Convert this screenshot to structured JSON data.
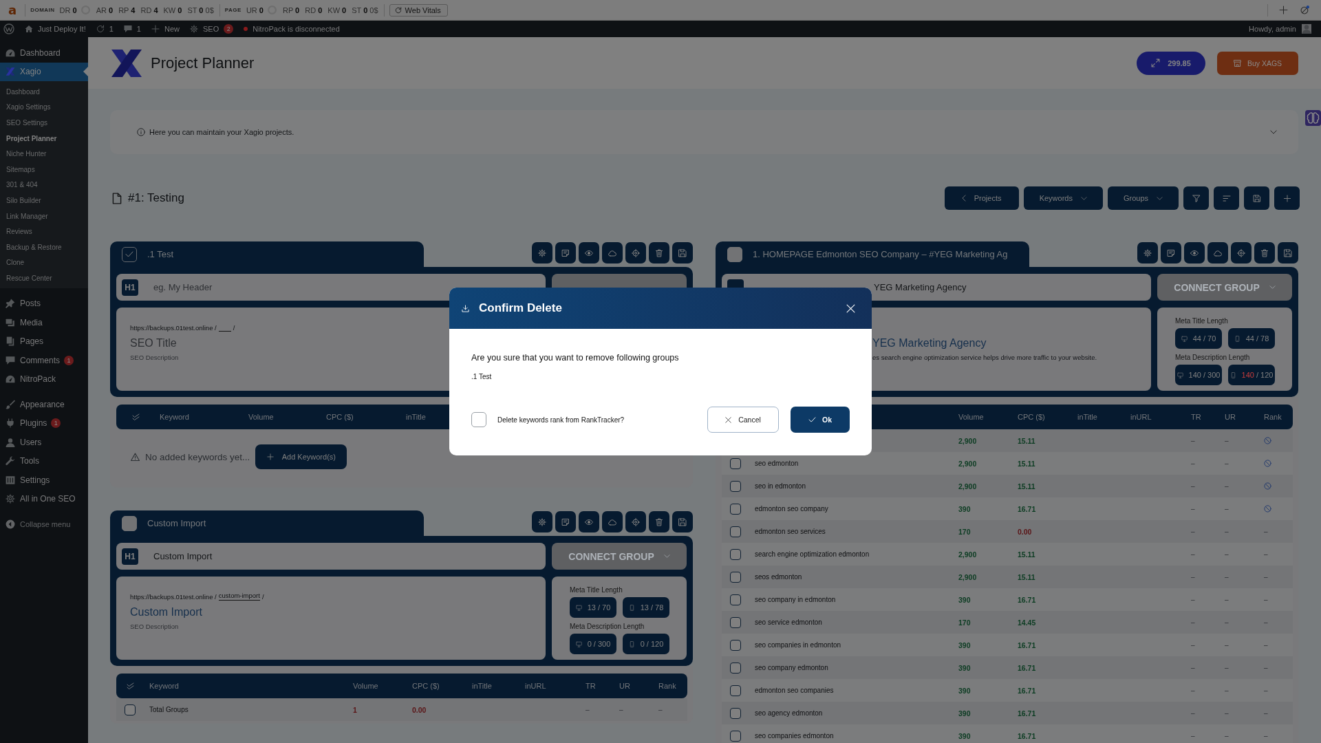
{
  "extension_bar": {
    "logo": "a",
    "sections": [
      {
        "label": "DOMAIN",
        "metrics": [
          {
            "kind": "metric",
            "name": "DR",
            "value": "0"
          },
          {
            "kind": "ring"
          },
          {
            "kind": "metric",
            "name": "AR",
            "value": "0"
          },
          {
            "kind": "metric",
            "name": "RP",
            "value": "4"
          },
          {
            "kind": "metric",
            "name": "RD",
            "value": "4"
          },
          {
            "kind": "metric",
            "name": "KW",
            "value": "0"
          },
          {
            "kind": "metric",
            "name": "ST",
            "value": "0",
            "extra": "0$"
          }
        ]
      },
      {
        "label": "PAGE",
        "metrics": [
          {
            "kind": "metric",
            "name": "UR",
            "value": "0"
          },
          {
            "kind": "ring"
          },
          {
            "kind": "metric",
            "name": "RP",
            "value": "0"
          },
          {
            "kind": "metric",
            "name": "RD",
            "value": "0"
          },
          {
            "kind": "metric",
            "name": "KW",
            "value": "0"
          },
          {
            "kind": "metric",
            "name": "ST",
            "value": "0",
            "extra": "0$"
          }
        ]
      }
    ],
    "button": "Web Vitals"
  },
  "admin_bar": {
    "items": [
      {
        "kind": "logo"
      },
      {
        "kind": "home",
        "label": "Just Deploy It!"
      },
      {
        "kind": "updates",
        "label": "1"
      },
      {
        "kind": "comments",
        "label": "1"
      },
      {
        "kind": "new",
        "label": "New"
      },
      {
        "kind": "seo",
        "label": "SEO",
        "badge": "2"
      },
      {
        "kind": "alert",
        "label": "NitroPack is disconnected"
      }
    ],
    "greeting": "Howdy, admin"
  },
  "sidebar": {
    "menu_groups": [
      [
        {
          "kind": "dashboard",
          "label": "Dashboard",
          "selected": false
        },
        {
          "kind": "xagio",
          "label": "Xagio",
          "selected": true,
          "children": [
            {
              "label": "Dashboard",
              "selected": false
            },
            {
              "label": "Xagio Settings",
              "selected": false
            },
            {
              "label": "SEO Settings",
              "selected": false
            },
            {
              "label": "Project Planner",
              "selected": true
            },
            {
              "label": "Niche Hunter",
              "selected": false
            },
            {
              "label": "Sitemaps",
              "selected": false
            },
            {
              "label": "301 & 404",
              "selected": false
            },
            {
              "label": "Silo Builder",
              "selected": false
            },
            {
              "label": "Link Manager",
              "selected": false
            },
            {
              "label": "Reviews",
              "selected": false
            },
            {
              "label": "Backup & Restore",
              "selected": false
            },
            {
              "label": "Clone",
              "selected": false
            },
            {
              "label": "Rescue Center",
              "selected": false
            }
          ]
        }
      ],
      [
        {
          "kind": "posts",
          "label": "Posts",
          "selected": false
        },
        {
          "kind": "media",
          "label": "Media",
          "selected": false
        },
        {
          "kind": "pages",
          "label": "Pages",
          "selected": false
        },
        {
          "kind": "comments",
          "label": "Comments",
          "badge": "1",
          "selected": false
        },
        {
          "kind": "nitropack",
          "label": "NitroPack",
          "selected": false
        }
      ],
      [
        {
          "kind": "appearance",
          "label": "Appearance",
          "selected": false
        },
        {
          "kind": "plugins",
          "label": "Plugins",
          "badge": "1",
          "selected": false
        },
        {
          "kind": "users",
          "label": "Users",
          "selected": false
        },
        {
          "kind": "tools",
          "label": "Tools",
          "selected": false
        },
        {
          "kind": "settings",
          "label": "Settings",
          "selected": false
        },
        {
          "kind": "aioseo",
          "label": "All in One SEO",
          "selected": false
        }
      ]
    ],
    "collapse": "Collapse menu"
  },
  "header": {
    "title": "Project Planner",
    "buttons": [
      {
        "kind": "credits",
        "label": "299.85"
      },
      {
        "kind": "buy",
        "label": "Buy XAGS"
      }
    ]
  },
  "notice": {
    "text": "Here you can maintain your Xagio projects.",
    "expanded": false
  },
  "project": {
    "title": "#1: Testing",
    "toolbar": [
      {
        "kind": "back",
        "label": "Projects"
      },
      {
        "kind": "dropdown",
        "label": "Keywords"
      },
      {
        "kind": "dropdown",
        "label": "Groups"
      },
      {
        "kind": "filter"
      },
      {
        "kind": "sort"
      },
      {
        "kind": "save"
      },
      {
        "kind": "add"
      }
    ]
  },
  "columns": [
    [
      {
        "title": ".1 Test",
        "checked": true,
        "h1": {
          "badge": "H1",
          "placeholder": "eg. My Header"
        },
        "seo": {
          "url": {
            "base": "https://backups.01test.online /",
            "end": "/"
          },
          "title": {
            "placeholder": "SEO Title"
          },
          "description": {
            "placeholder": "SEO Description"
          }
        },
        "table": {
          "select_all": true,
          "columns": [
            {
              "kind": "keyword",
              "label": "Keyword"
            },
            {
              "kind": "volume",
              "label": "Volume"
            },
            {
              "kind": "cpc",
              "label": "CPC ($)"
            },
            {
              "kind": "intitle",
              "label": "inTitle"
            }
          ],
          "empty": {
            "text": "No added keywords yet...",
            "button": "Add Keyword(s)"
          }
        }
      },
      {
        "title": "Custom Import",
        "checked": false,
        "h1": {
          "badge": "H1",
          "value": "Custom Import"
        },
        "connect": "CONNECT GROUP",
        "seo": {
          "url": {
            "base": "https://backups.01test.online /",
            "slug": "custom-import",
            "end": "/"
          },
          "title": {
            "value": "Custom Import"
          },
          "description": {
            "placeholder": "SEO Description"
          }
        },
        "meta": {
          "title_label": "Meta Title Length",
          "title_counts": [
            {
              "kind": "desktop",
              "count": "13",
              "total": "/ 70",
              "over": false
            },
            {
              "kind": "mobile",
              "count": "13",
              "total": "/ 78",
              "over": false
            }
          ],
          "description_label": "Meta Description Length",
          "description_counts": [
            {
              "kind": "desktop",
              "count": "0",
              "total": "/ 300",
              "over": false
            },
            {
              "kind": "mobile",
              "count": "0",
              "total": "/ 120",
              "over": false
            }
          ]
        },
        "table": {
          "select_all": true,
          "columns": [
            {
              "kind": "keyword",
              "label": "Keyword"
            },
            {
              "kind": "volume",
              "label": "Volume"
            },
            {
              "kind": "cpc",
              "label": "CPC ($)"
            },
            {
              "kind": "intitle",
              "label": "inTitle"
            },
            {
              "kind": "inurl",
              "label": "inURL"
            },
            {
              "kind": "tr",
              "label": "TR"
            },
            {
              "kind": "ur",
              "label": "UR"
            },
            {
              "kind": "rank",
              "label": "Rank"
            }
          ],
          "rows": [
            {
              "checked": false,
              "keyword": "Total Groups",
              "volume": {
                "text": "1",
                "color": "#5a1416"
              },
              "cpc": {
                "text": "0.00",
                "color": "#5a1416"
              },
              "tr": "–",
              "ur": "–",
              "rank": {
                "kind": "text",
                "text": "–"
              }
            }
          ]
        }
      }
    ],
    [
      {
        "title": "1. HOMEPAGE Edmonton SEO Company – #YEG Marketing Ag",
        "checked": false,
        "h1": {
          "value": "YEG Marketing Agency"
        },
        "connect": "CONNECT GROUP",
        "seo": {
          "title": {
            "value": "YEG Marketing Agency"
          },
          "description": {
            "value": "es search engine optimization service helps drive more traffic to your website."
          }
        },
        "meta": {
          "title_label": "Meta Title Length",
          "title_counts": [
            {
              "kind": "desktop",
              "count": "44",
              "total": "/ 70",
              "over": false
            },
            {
              "kind": "mobile",
              "count": "44",
              "total": "/ 78",
              "over": false
            }
          ],
          "description_label": "Meta Description Length",
          "description_counts": [
            {
              "kind": "desktop",
              "count": "140",
              "total": "/ 300",
              "over": false
            },
            {
              "kind": "mobile",
              "count": "140",
              "total": "/ 120",
              "over": true
            }
          ]
        },
        "table": {
          "columns": [
            {
              "kind": "keyword"
            },
            {
              "kind": "volume",
              "label": "Volume"
            },
            {
              "kind": "cpc",
              "label": "CPC ($)"
            },
            {
              "kind": "intitle",
              "label": "inTitle"
            },
            {
              "kind": "inurl",
              "label": "inURL"
            },
            {
              "kind": "tr",
              "label": "TR"
            },
            {
              "kind": "ur",
              "label": "UR"
            },
            {
              "kind": "rank",
              "label": "Rank"
            }
          ],
          "rows": [
            {
              "volume": {
                "text": "2,900",
                "color": "#0c3c22"
              },
              "cpc": {
                "text": "15.11",
                "color": "#0c3c22"
              },
              "tr": "–",
              "ur": "–",
              "rank": {
                "kind": "icon"
              }
            },
            {
              "checked": false,
              "keyword": "seo edmonton",
              "volume": {
                "text": "2,900",
                "color": "#0c3c22"
              },
              "cpc": {
                "text": "15.11",
                "color": "#0c3c22"
              },
              "tr": "–",
              "ur": "–",
              "rank": {
                "kind": "icon"
              }
            },
            {
              "checked": false,
              "keyword": "seo in edmonton",
              "volume": {
                "text": "2,900",
                "color": "#0c3c22"
              },
              "cpc": {
                "text": "15.11",
                "color": "#0c3c22"
              },
              "tr": "–",
              "ur": "–",
              "rank": {
                "kind": "icon"
              }
            },
            {
              "checked": false,
              "keyword": "edmonton seo company",
              "volume": {
                "text": "390",
                "color": "#0c3c22"
              },
              "cpc": {
                "text": "16.71",
                "color": "#0c3c22"
              },
              "tr": "–",
              "ur": "–",
              "rank": {
                "kind": "icon"
              }
            },
            {
              "checked": false,
              "keyword": "edmonton seo services",
              "volume": {
                "text": "170",
                "color": "#0c3c22"
              },
              "cpc": {
                "text": "0.00",
                "color": "#5a1416"
              },
              "tr": "–",
              "ur": "–",
              "rank": {
                "kind": "text",
                "text": "–"
              }
            },
            {
              "checked": false,
              "keyword": "search engine optimization edmonton",
              "volume": {
                "text": "2,900",
                "color": "#0c3c22"
              },
              "cpc": {
                "text": "15.11",
                "color": "#0c3c22"
              },
              "tr": "–",
              "ur": "–",
              "rank": {
                "kind": "text",
                "text": "–"
              }
            },
            {
              "checked": false,
              "keyword": "seos edmonton",
              "volume": {
                "text": "2,900",
                "color": "#0c3c22"
              },
              "cpc": {
                "text": "15.11",
                "color": "#0c3c22"
              },
              "tr": "–",
              "ur": "–",
              "rank": {
                "kind": "text",
                "text": "–"
              }
            },
            {
              "checked": false,
              "keyword": "seo company in edmonton",
              "volume": {
                "text": "390",
                "color": "#0c3c22"
              },
              "cpc": {
                "text": "16.71",
                "color": "#0c3c22"
              },
              "tr": "–",
              "ur": "–",
              "rank": {
                "kind": "text",
                "text": "–"
              }
            },
            {
              "checked": false,
              "keyword": "seo service edmonton",
              "volume": {
                "text": "170",
                "color": "#0c3c22"
              },
              "cpc": {
                "text": "14.45",
                "color": "#0c3c22"
              },
              "tr": "–",
              "ur": "–",
              "rank": {
                "kind": "text",
                "text": "–"
              }
            },
            {
              "checked": false,
              "keyword": "seo companies in edmonton",
              "volume": {
                "text": "390",
                "color": "#0c3c22"
              },
              "cpc": {
                "text": "16.71",
                "color": "#0c3c22"
              },
              "tr": "–",
              "ur": "–",
              "rank": {
                "kind": "text",
                "text": "–"
              }
            },
            {
              "checked": false,
              "keyword": "seo company edmonton",
              "volume": {
                "text": "390",
                "color": "#0c3c22"
              },
              "cpc": {
                "text": "16.71",
                "color": "#0c3c22"
              },
              "tr": "–",
              "ur": "–",
              "rank": {
                "kind": "text",
                "text": "–"
              }
            },
            {
              "checked": false,
              "keyword": "edmonton seo companies",
              "volume": {
                "text": "390",
                "color": "#0c3c22"
              },
              "cpc": {
                "text": "16.71",
                "color": "#0c3c22"
              },
              "tr": "–",
              "ur": "–",
              "rank": {
                "kind": "text",
                "text": "–"
              }
            },
            {
              "checked": false,
              "keyword": "seo agency edmonton",
              "volume": {
                "text": "390",
                "color": "#0c3c22"
              },
              "cpc": {
                "text": "16.71",
                "color": "#0c3c22"
              },
              "tr": "–",
              "ur": "–",
              "rank": {
                "kind": "text",
                "text": "–"
              }
            },
            {
              "checked": false,
              "keyword": "seo companies edmonton",
              "volume": {
                "text": "390",
                "color": "#0c3c22"
              },
              "cpc": {
                "text": "16.71",
                "color": "#0c3c22"
              },
              "tr": "–",
              "ur": "–",
              "rank": {
                "kind": "text",
                "text": "–"
              }
            }
          ]
        }
      }
    ]
  ],
  "modal": {
    "title": "Confirm Delete",
    "question": "Are you sure that you want to remove following groups",
    "groups": [
      ".1 Test"
    ],
    "option": {
      "label": "Delete keywords rank from RankTracker?",
      "checked": false
    },
    "buttons": [
      {
        "kind": "cancel",
        "label": "Cancel"
      },
      {
        "kind": "ok",
        "label": "Ok"
      }
    ]
  }
}
